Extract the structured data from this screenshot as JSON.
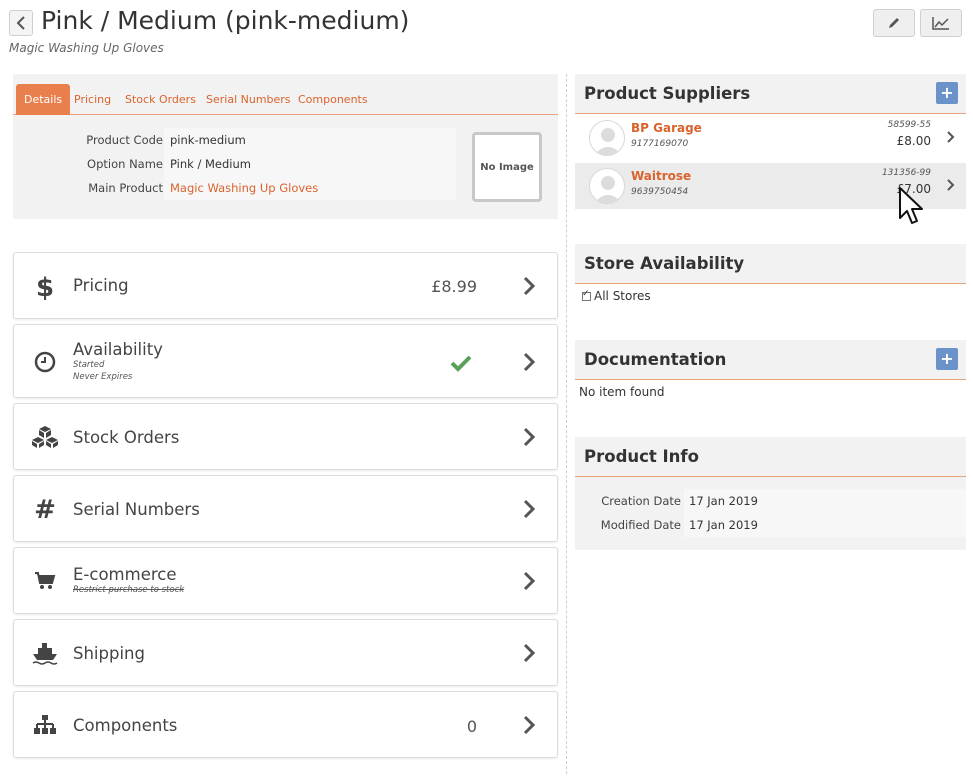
{
  "header": {
    "title": "Pink / Medium (pink-medium)",
    "subtitle": "Magic Washing Up Gloves"
  },
  "tabs": [
    {
      "label": "Details",
      "active": true
    },
    {
      "label": "Pricing"
    },
    {
      "label": "Stock Orders"
    },
    {
      "label": "Serial Numbers"
    },
    {
      "label": "Components"
    }
  ],
  "details": {
    "product_code_label": "Product Code",
    "product_code": "pink-medium",
    "option_name_label": "Option Name",
    "option_name": "Pink / Medium",
    "main_product_label": "Main Product",
    "main_product": "Magic Washing Up Gloves",
    "no_image": "No Image"
  },
  "cards": {
    "pricing": {
      "label": "Pricing",
      "value": "£8.99"
    },
    "availability": {
      "label": "Availability",
      "sub1": "Started",
      "sub2": "Never Expires"
    },
    "stock_orders": {
      "label": "Stock Orders"
    },
    "serial_numbers": {
      "label": "Serial Numbers"
    },
    "ecommerce": {
      "label": "E-commerce",
      "sub": "Restrict purchase to stock"
    },
    "shipping": {
      "label": "Shipping"
    },
    "components": {
      "label": "Components",
      "value": "0"
    }
  },
  "suppliers": {
    "title": "Product Suppliers",
    "items": [
      {
        "name": "BP Garage",
        "phone": "9177169070",
        "code": "58599-55",
        "price": "£8.00"
      },
      {
        "name": "Waitrose",
        "phone": "9639750454",
        "code": "131356-99",
        "price": "£7.00"
      }
    ]
  },
  "store_availability": {
    "title": "Store Availability",
    "all_stores": "All Stores"
  },
  "documentation": {
    "title": "Documentation",
    "empty": "No item found"
  },
  "product_info": {
    "title": "Product Info",
    "creation_label": "Creation Date",
    "creation_date": "17 Jan 2019",
    "modified_label": "Modified Date",
    "modified_date": "17 Jan 2019"
  },
  "colors": {
    "accent": "#e87f4c",
    "link": "#d9632c",
    "check_green": "#5aa05a",
    "plus_blue": "#6b93c9"
  }
}
